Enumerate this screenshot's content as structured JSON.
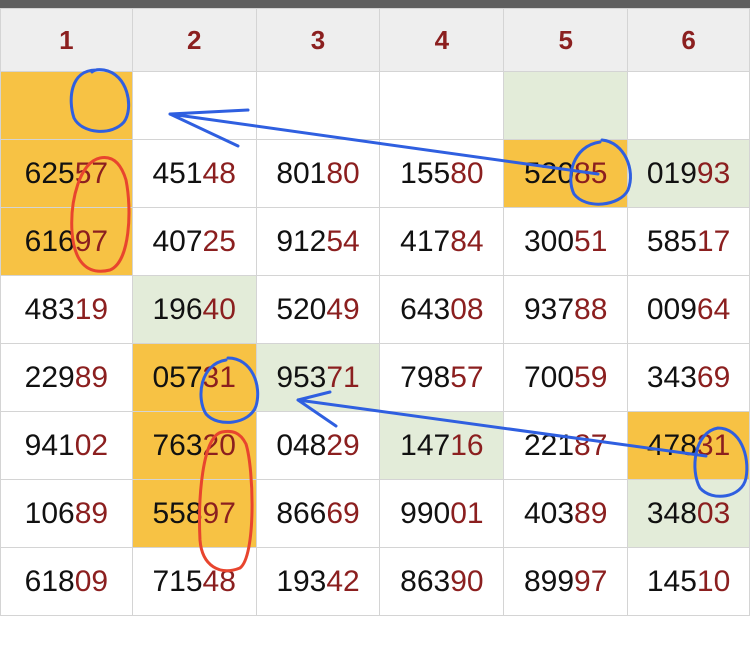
{
  "table": {
    "headers": [
      "1",
      "2",
      "3",
      "4",
      "5",
      "6"
    ],
    "top_row_highlights": [
      "yellow",
      "white",
      "white",
      "white",
      "green",
      "white"
    ],
    "rows": [
      [
        {
          "pre": "625",
          "suf": "57",
          "bg": "yellow"
        },
        {
          "pre": "451",
          "suf": "48",
          "bg": "white"
        },
        {
          "pre": "801",
          "suf": "80",
          "bg": "white"
        },
        {
          "pre": "155",
          "suf": "80",
          "bg": "white"
        },
        {
          "pre": "520",
          "suf": "85",
          "bg": "yellow"
        },
        {
          "pre": "019",
          "suf": "93",
          "bg": "green"
        }
      ],
      [
        {
          "pre": "616",
          "suf": "97",
          "bg": "yellow"
        },
        {
          "pre": "407",
          "suf": "25",
          "bg": "white"
        },
        {
          "pre": "912",
          "suf": "54",
          "bg": "white"
        },
        {
          "pre": "417",
          "suf": "84",
          "bg": "white"
        },
        {
          "pre": "300",
          "suf": "51",
          "bg": "white"
        },
        {
          "pre": "585",
          "suf": "17",
          "bg": "white"
        }
      ],
      [
        {
          "pre": "483",
          "suf": "19",
          "bg": "white"
        },
        {
          "pre": "196",
          "suf": "40",
          "bg": "green"
        },
        {
          "pre": "520",
          "suf": "49",
          "bg": "white"
        },
        {
          "pre": "643",
          "suf": "08",
          "bg": "white"
        },
        {
          "pre": "937",
          "suf": "88",
          "bg": "white"
        },
        {
          "pre": "009",
          "suf": "64",
          "bg": "white"
        }
      ],
      [
        {
          "pre": "229",
          "suf": "89",
          "bg": "white"
        },
        {
          "pre": "057",
          "suf": "31",
          "bg": "yellow"
        },
        {
          "pre": "953",
          "suf": "71",
          "bg": "green"
        },
        {
          "pre": "798",
          "suf": "57",
          "bg": "white"
        },
        {
          "pre": "700",
          "suf": "59",
          "bg": "white"
        },
        {
          "pre": "343",
          "suf": "69",
          "bg": "white"
        }
      ],
      [
        {
          "pre": "941",
          "suf": "02",
          "bg": "white"
        },
        {
          "pre": "763",
          "suf": "20",
          "bg": "yellow"
        },
        {
          "pre": "048",
          "suf": "29",
          "bg": "white"
        },
        {
          "pre": "147",
          "suf": "16",
          "bg": "green"
        },
        {
          "pre": "221",
          "suf": "87",
          "bg": "white"
        },
        {
          "pre": "478",
          "suf": "31",
          "bg": "yellow"
        }
      ],
      [
        {
          "pre": "106",
          "suf": "89",
          "bg": "white"
        },
        {
          "pre": "558",
          "suf": "97",
          "bg": "yellow"
        },
        {
          "pre": "866",
          "suf": "69",
          "bg": "white"
        },
        {
          "pre": "990",
          "suf": "01",
          "bg": "white"
        },
        {
          "pre": "403",
          "suf": "89",
          "bg": "white"
        },
        {
          "pre": "348",
          "suf": "03",
          "bg": "green"
        }
      ],
      [
        {
          "pre": "618",
          "suf": "09",
          "bg": "white"
        },
        {
          "pre": "715",
          "suf": "48",
          "bg": "white"
        },
        {
          "pre": "193",
          "suf": "42",
          "bg": "white"
        },
        {
          "pre": "863",
          "suf": "90",
          "bg": "white"
        },
        {
          "pre": "899",
          "suf": "97",
          "bg": "white"
        },
        {
          "pre": "145",
          "suf": "10",
          "bg": "white"
        }
      ]
    ]
  },
  "colors": {
    "header_text": "#8b1f1f",
    "suffix_text": "#8b1f1f",
    "number_text": "#111111",
    "highlight_yellow": "#f7c244",
    "highlight_green": "#e3ecd9",
    "annotation_blue": "#2f5fe0",
    "annotation_red": "#e8452e"
  },
  "annotations": {
    "blue_circles": [
      "header-row-col1",
      "row1-col5",
      "row4-col2",
      "row5-col6"
    ],
    "red_outlines": [
      "rows1-2-col1",
      "rows5-6-col2"
    ],
    "arrows": [
      "row1-col5-to-top-row-col2",
      "row5-col6-to-row4-col3"
    ]
  }
}
